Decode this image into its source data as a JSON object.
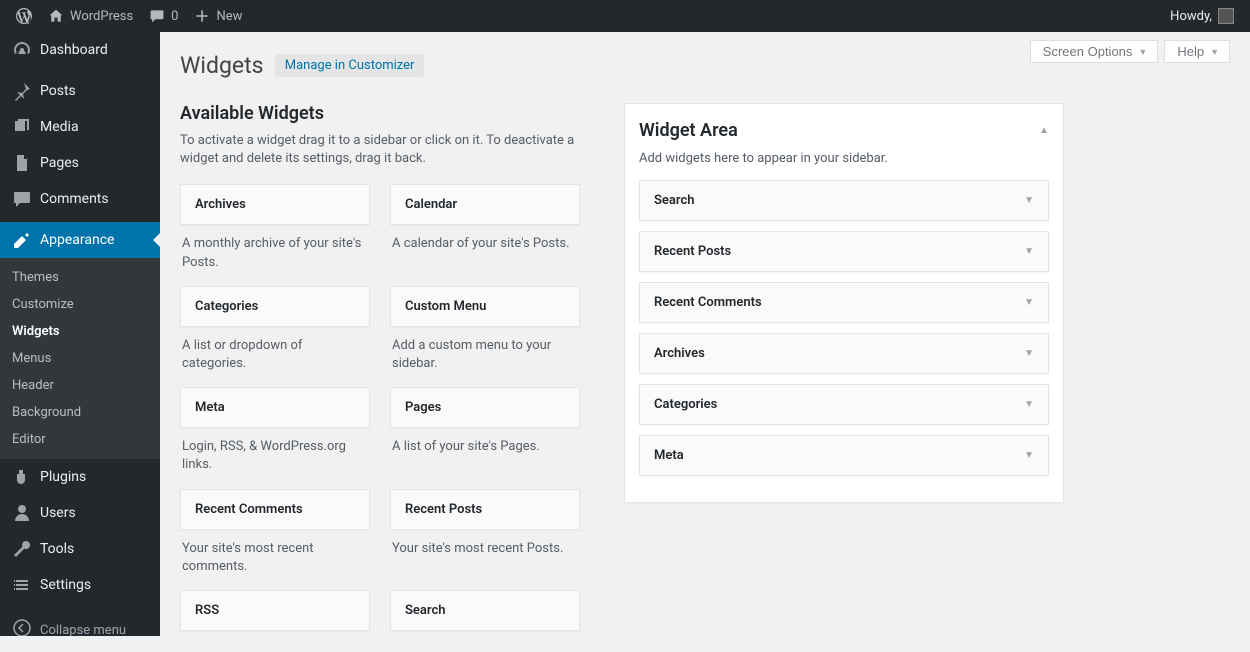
{
  "adminbar": {
    "site_name": "WordPress",
    "comments_count": "0",
    "new_label": "New",
    "howdy_prefix": "Howdy,"
  },
  "menu": {
    "dashboard": "Dashboard",
    "posts": "Posts",
    "media": "Media",
    "pages": "Pages",
    "comments": "Comments",
    "appearance": "Appearance",
    "plugins": "Plugins",
    "users": "Users",
    "tools": "Tools",
    "settings": "Settings",
    "collapse": "Collapse menu",
    "appearance_sub": {
      "themes": "Themes",
      "customize": "Customize",
      "widgets": "Widgets",
      "menus": "Menus",
      "header": "Header",
      "background": "Background",
      "editor": "Editor"
    }
  },
  "topbuttons": {
    "screen_options": "Screen Options",
    "help": "Help"
  },
  "header": {
    "page_title": "Widgets",
    "title_action": "Manage in Customizer"
  },
  "available": {
    "heading": "Available Widgets",
    "description": "To activate a widget drag it to a sidebar or click on it. To deactivate a widget and delete its settings, drag it back.",
    "widgets": [
      {
        "title": "Archives",
        "desc": "A monthly archive of your site's Posts."
      },
      {
        "title": "Calendar",
        "desc": "A calendar of your site's Posts."
      },
      {
        "title": "Categories",
        "desc": "A list or dropdown of categories."
      },
      {
        "title": "Custom Menu",
        "desc": "Add a custom menu to your sidebar."
      },
      {
        "title": "Meta",
        "desc": "Login, RSS, & WordPress.org links."
      },
      {
        "title": "Pages",
        "desc": "A list of your site's Pages."
      },
      {
        "title": "Recent Comments",
        "desc": "Your site's most recent comments."
      },
      {
        "title": "Recent Posts",
        "desc": "Your site's most recent Posts."
      },
      {
        "title": "RSS",
        "desc": ""
      },
      {
        "title": "Search",
        "desc": ""
      }
    ]
  },
  "widget_area": {
    "title": "Widget Area",
    "description": "Add widgets here to appear in your sidebar.",
    "items": [
      {
        "title": "Search"
      },
      {
        "title": "Recent Posts"
      },
      {
        "title": "Recent Comments"
      },
      {
        "title": "Archives"
      },
      {
        "title": "Categories"
      },
      {
        "title": "Meta"
      }
    ]
  }
}
